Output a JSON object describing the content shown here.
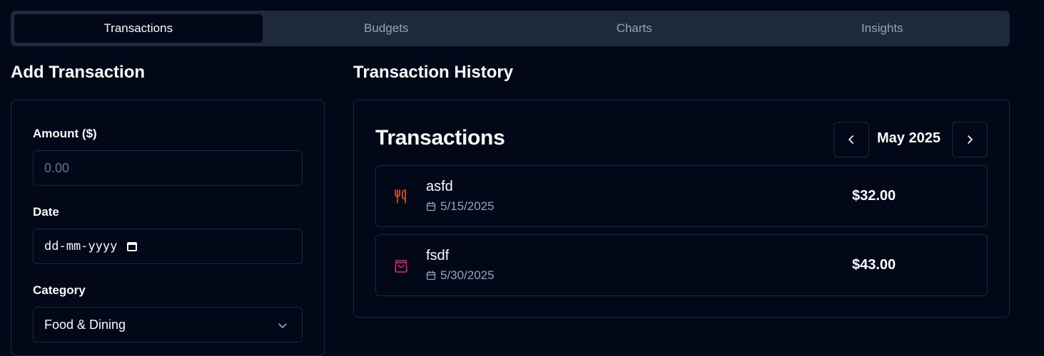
{
  "tabs": [
    "Transactions",
    "Budgets",
    "Charts",
    "Insights"
  ],
  "active_tab": 0,
  "add_form": {
    "title": "Add Transaction",
    "amount_label": "Amount ($)",
    "amount_placeholder": "0.00",
    "date_label": "Date",
    "date_placeholder": "dd-mm-yyyy",
    "category_label": "Category",
    "category_value": "Food & Dining"
  },
  "history": {
    "title": "Transaction History",
    "card_title": "Transactions",
    "month": "May 2025",
    "transactions": [
      {
        "name": "asfd",
        "date": "5/15/2025",
        "amount": "$32.00",
        "icon": "utensils-icon",
        "icon_color": "#ea580c"
      },
      {
        "name": "fsdf",
        "date": "5/30/2025",
        "amount": "$43.00",
        "icon": "shopping-bag-icon",
        "icon_color": "#db2777"
      }
    ]
  },
  "colors": {
    "background": "#020817",
    "tab_bar": "#1e293b",
    "border": "#1e293b",
    "muted_text": "#94a3b8",
    "text": "#f8fafc"
  }
}
